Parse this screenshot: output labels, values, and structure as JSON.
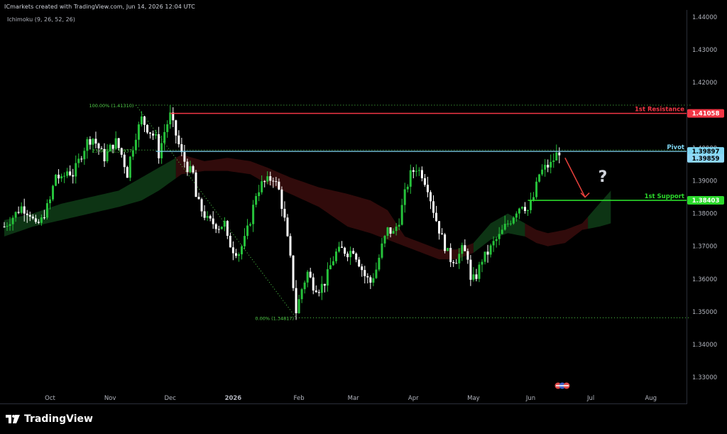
{
  "header": {
    "title": "ICmarkets created with TradingView.com, Jun 14, 2026 12:04 UTC",
    "indicator": "Ichimoku (9, 26, 52, 26)"
  },
  "footer": {
    "brand": "TradingView"
  },
  "colors": {
    "background": "#000000",
    "bull": "#26c23b",
    "bear": "#ffffff",
    "resistance": "#f23645",
    "support": "#2bd92b",
    "pivot": "#7fd6f2",
    "pivot_alt": "#8ed8f8",
    "cloud_bull": "#0f3d17",
    "cloud_bear": "#3a0d0d",
    "fib": "#52d14a",
    "arrow": "#e8413c"
  },
  "chart_data": {
    "type": "candlestick",
    "symbol_note": "",
    "ylim": [
      1.325,
      1.445
    ],
    "y_ticks": [
      "1.44000",
      "1.43000",
      "1.42000",
      "1.41000",
      "1.40000",
      "1.39000",
      "1.38000",
      "1.37000",
      "1.36000",
      "1.35000",
      "1.34000",
      "1.33000"
    ],
    "y_tick_values": [
      1.44,
      1.43,
      1.42,
      1.41,
      1.4,
      1.39,
      1.38,
      1.37,
      1.36,
      1.35,
      1.34,
      1.33
    ],
    "x_ticks": [
      "Oct",
      "Nov",
      "Dec",
      "2026",
      "Feb",
      "Mar",
      "Apr",
      "May",
      "Jun",
      "Jul",
      "Aug"
    ],
    "x_tick_bars": [
      16,
      37,
      58,
      80,
      103,
      122,
      143,
      164,
      184,
      205,
      226
    ],
    "bar_count": 195,
    "close_path": [
      [
        0,
        1.376
      ],
      [
        3,
        1.379
      ],
      [
        6,
        1.382
      ],
      [
        9,
        1.38
      ],
      [
        11,
        1.376
      ],
      [
        13,
        1.378
      ],
      [
        16,
        1.384
      ],
      [
        18,
        1.392
      ],
      [
        20,
        1.39
      ],
      [
        22,
        1.393
      ],
      [
        24,
        1.392
      ],
      [
        27,
        1.398
      ],
      [
        29,
        1.402
      ],
      [
        31,
        1.403
      ],
      [
        33,
        1.4
      ],
      [
        35,
        1.397
      ],
      [
        37,
        1.4
      ],
      [
        39,
        1.402
      ],
      [
        41,
        1.398
      ],
      [
        43,
        1.392
      ],
      [
        44,
        1.397
      ],
      [
        46,
        1.404
      ],
      [
        48,
        1.409
      ],
      [
        50,
        1.406
      ],
      [
        52,
        1.404
      ],
      [
        53,
        1.403
      ],
      [
        54,
        1.398
      ],
      [
        56,
        1.405
      ],
      [
        58,
        1.41
      ],
      [
        60,
        1.404
      ],
      [
        62,
        1.398
      ],
      [
        64,
        1.394
      ],
      [
        66,
        1.392
      ],
      [
        67,
        1.385
      ],
      [
        69,
        1.381
      ],
      [
        71,
        1.378
      ],
      [
        73,
        1.377
      ],
      [
        75,
        1.376
      ],
      [
        77,
        1.377
      ],
      [
        78,
        1.372
      ],
      [
        80,
        1.369
      ],
      [
        82,
        1.368
      ],
      [
        84,
        1.372
      ],
      [
        86,
        1.378
      ],
      [
        88,
        1.386
      ],
      [
        90,
        1.389
      ],
      [
        92,
        1.39
      ],
      [
        94,
        1.391
      ],
      [
        96,
        1.387
      ],
      [
        98,
        1.378
      ],
      [
        100,
        1.366
      ],
      [
        101,
        1.358
      ],
      [
        102,
        1.35
      ],
      [
        104,
        1.357
      ],
      [
        106,
        1.362
      ],
      [
        108,
        1.358
      ],
      [
        110,
        1.357
      ],
      [
        112,
        1.359
      ],
      [
        114,
        1.364
      ],
      [
        116,
        1.368
      ],
      [
        118,
        1.369
      ],
      [
        120,
        1.368
      ],
      [
        122,
        1.369
      ],
      [
        124,
        1.365
      ],
      [
        126,
        1.361
      ],
      [
        128,
        1.359
      ],
      [
        130,
        1.363
      ],
      [
        132,
        1.37
      ],
      [
        134,
        1.375
      ],
      [
        136,
        1.374
      ],
      [
        138,
        1.378
      ],
      [
        140,
        1.386
      ],
      [
        142,
        1.392
      ],
      [
        144,
        1.394
      ],
      [
        146,
        1.392
      ],
      [
        148,
        1.388
      ],
      [
        150,
        1.381
      ],
      [
        152,
        1.375
      ],
      [
        154,
        1.37
      ],
      [
        156,
        1.366
      ],
      [
        158,
        1.366
      ],
      [
        160,
        1.369
      ],
      [
        162,
        1.367
      ],
      [
        163,
        1.359
      ],
      [
        165,
        1.361
      ],
      [
        167,
        1.366
      ],
      [
        169,
        1.368
      ],
      [
        171,
        1.371
      ],
      [
        173,
        1.373
      ],
      [
        175,
        1.376
      ],
      [
        177,
        1.378
      ],
      [
        179,
        1.381
      ],
      [
        181,
        1.383
      ],
      [
        183,
        1.381
      ],
      [
        185,
        1.385
      ],
      [
        187,
        1.392
      ],
      [
        189,
        1.394
      ],
      [
        191,
        1.395
      ],
      [
        193,
        1.398
      ],
      [
        194,
        1.399
      ]
    ],
    "ichimoku_cloud": [
      [
        0,
        1.373,
        1.378
      ],
      [
        10,
        1.376,
        1.38
      ],
      [
        20,
        1.378,
        1.383
      ],
      [
        30,
        1.38,
        1.385
      ],
      [
        40,
        1.382,
        1.387
      ],
      [
        48,
        1.384,
        1.391
      ],
      [
        54,
        1.387,
        1.394
      ],
      [
        62,
        1.392,
        1.398
      ],
      [
        70,
        1.393,
        1.396
      ],
      [
        78,
        1.393,
        1.397
      ],
      [
        86,
        1.392,
        1.396
      ],
      [
        92,
        1.389,
        1.394
      ],
      [
        100,
        1.386,
        1.391
      ],
      [
        110,
        1.382,
        1.388
      ],
      [
        120,
        1.376,
        1.386
      ],
      [
        128,
        1.374,
        1.384
      ],
      [
        134,
        1.372,
        1.381
      ],
      [
        140,
        1.37,
        1.373
      ],
      [
        146,
        1.368,
        1.371
      ],
      [
        152,
        1.366,
        1.369
      ],
      [
        158,
        1.366,
        1.369
      ],
      [
        164,
        1.368,
        1.371
      ],
      [
        170,
        1.372,
        1.377
      ],
      [
        176,
        1.374,
        1.38
      ],
      [
        182,
        1.373,
        1.377
      ],
      [
        186,
        1.371,
        1.375
      ],
      [
        190,
        1.37,
        1.374
      ],
      [
        196,
        1.371,
        1.375
      ],
      [
        202,
        1.375,
        1.377
      ],
      [
        208,
        1.376,
        1.383
      ],
      [
        212,
        1.377,
        1.387
      ]
    ],
    "cloud_color_segments": [
      {
        "from": 0,
        "to": 60,
        "color": "bull"
      },
      {
        "from": 60,
        "to": 164,
        "color": "bear"
      },
      {
        "from": 164,
        "to": 182,
        "color": "bull"
      },
      {
        "from": 182,
        "to": 204,
        "color": "bear"
      },
      {
        "from": 204,
        "to": 212,
        "color": "bull"
      }
    ],
    "levels": [
      {
        "name": "1st Resistance",
        "value": 1.41058,
        "label": "1.41058",
        "start_bar": 58,
        "color": "resistance"
      },
      {
        "name": "Pivot",
        "value": 1.39897,
        "label": "1.39897",
        "start_bar": 53,
        "color": "pivot"
      },
      {
        "name": "1st Support",
        "value": 1.38403,
        "label": "1.38403",
        "start_bar": 183,
        "color": "support"
      }
    ],
    "price_tag_current": {
      "value": 1.39859,
      "label": "1.39859"
    },
    "fib": {
      "high": {
        "text": "100.00% (1.41310)",
        "value": 1.4131,
        "bar": 46
      },
      "mid": {
        "text": "23.60% (1.39937)",
        "value": 1.39937,
        "bar": 46
      },
      "low": {
        "text": "0.00% (1.34817)",
        "value": 1.34817,
        "bar": 102
      },
      "end_bar": 240
    },
    "annotations": {
      "question_mark": "?",
      "arrow_from": [
        196,
        1.397
      ],
      "arrow_to": [
        203,
        1.385
      ]
    }
  }
}
